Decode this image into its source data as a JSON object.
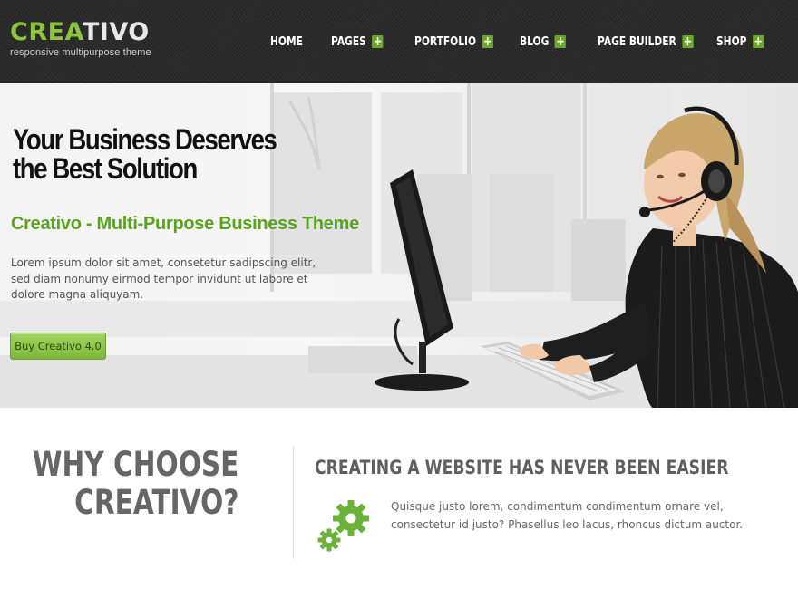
{
  "header": {
    "logo": {
      "part1": "CREA",
      "part2": "TIVO",
      "tagline": "responsive multipurpose theme"
    },
    "nav": [
      {
        "label": "HOME",
        "has_submenu": false
      },
      {
        "label": "PAGES",
        "has_submenu": true
      },
      {
        "label": "PORTFOLIO",
        "has_submenu": true
      },
      {
        "label": "BLOG",
        "has_submenu": true
      },
      {
        "label": "PAGE BUILDER",
        "has_submenu": true
      },
      {
        "label": "SHOP",
        "has_submenu": true
      }
    ],
    "submenu_icon": "plus-icon"
  },
  "hero": {
    "title_line1": "Your Business Deserves",
    "title_line2": "the Best Solution",
    "subtitle": "Creativo - Multi-Purpose Business Theme",
    "text": "Lorem ipsum dolor sit amet, consetetur sadipscing elitr, sed diam nonumy eirmod tempor invidunt ut labore et dolore magna aliquyam.",
    "button_label": "Buy Creativo 4.0",
    "image": "woman-at-computer-with-headset"
  },
  "why": {
    "title_line1": "WHY CHOOSE",
    "title_line2": "CREATIVO?"
  },
  "feature": {
    "title": "CREATING A WEBSITE HAS NEVER BEEN EASIER",
    "icon": "gears-icon",
    "text": "Quisque justo lorem, condimentum condimentum ornare vel, consectetur id justo? Phasellus leo lacus, rhoncus dictum auctor."
  },
  "colors": {
    "accent": "#8cc63e",
    "accent_dark": "#5aa41d",
    "header_bg": "#2b2b2b",
    "title_gray": "#666666"
  }
}
